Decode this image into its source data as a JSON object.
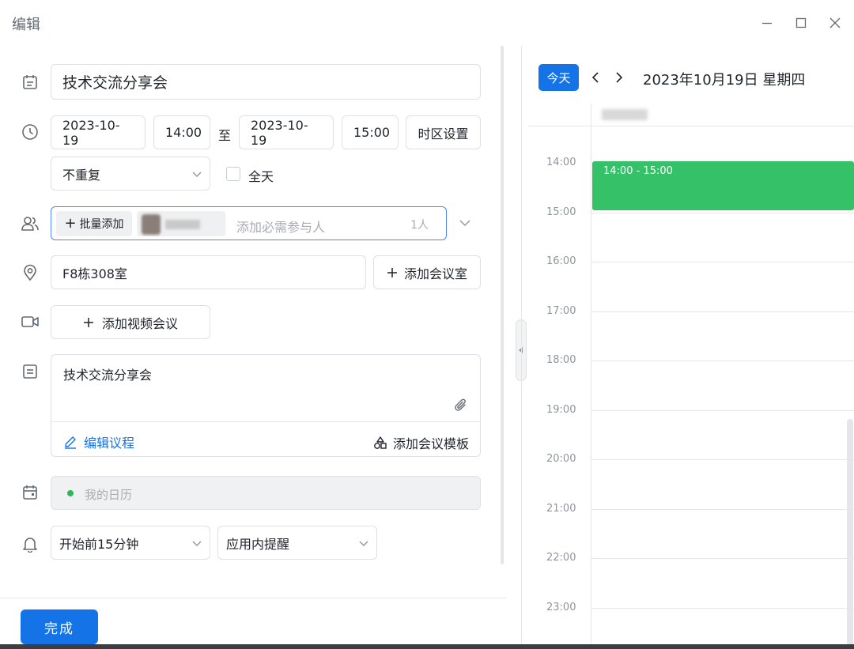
{
  "window": {
    "title": "编辑",
    "minimize_icon": "minimize-icon",
    "maximize_icon": "maximize-icon",
    "close_icon": "close-icon"
  },
  "form": {
    "title_value": "技术交流分享会",
    "start_date": "2023-10-19",
    "start_time": "14:00",
    "range_separator": "至",
    "end_date": "2023-10-19",
    "end_time": "15:00",
    "timezone_button": "时区设置",
    "repeat_value": "不重复",
    "all_day_label": "全天",
    "all_day_checked": false,
    "attendees": {
      "batch_add_label": "批量添加",
      "placeholder": "添加必需参与人",
      "count": "1人"
    },
    "location_value": "F8栋308室",
    "add_room_label": "添加会议室",
    "add_video_label": "添加视频会议",
    "description_text": "技术交流分享会",
    "edit_agenda_label": "编辑议程",
    "add_template_label": "添加会议模板",
    "calendar_label": "我的日历",
    "calendar_color": "#2db85c",
    "reminder_value": "开始前15分钟",
    "reminder_type_value": "应用内提醒",
    "done_label": "完成"
  },
  "calendar": {
    "today_label": "今天",
    "date_label": "2023年10月19日 星期四",
    "hours": [
      "14:00",
      "15:00",
      "16:00",
      "17:00",
      "18:00",
      "19:00",
      "20:00",
      "21:00",
      "22:00",
      "23:00"
    ],
    "event": {
      "time_label": "14:00 - 15:00",
      "color": "#34c168"
    }
  },
  "colors": {
    "accent": "#1473e6",
    "border": "#dee0e3"
  }
}
